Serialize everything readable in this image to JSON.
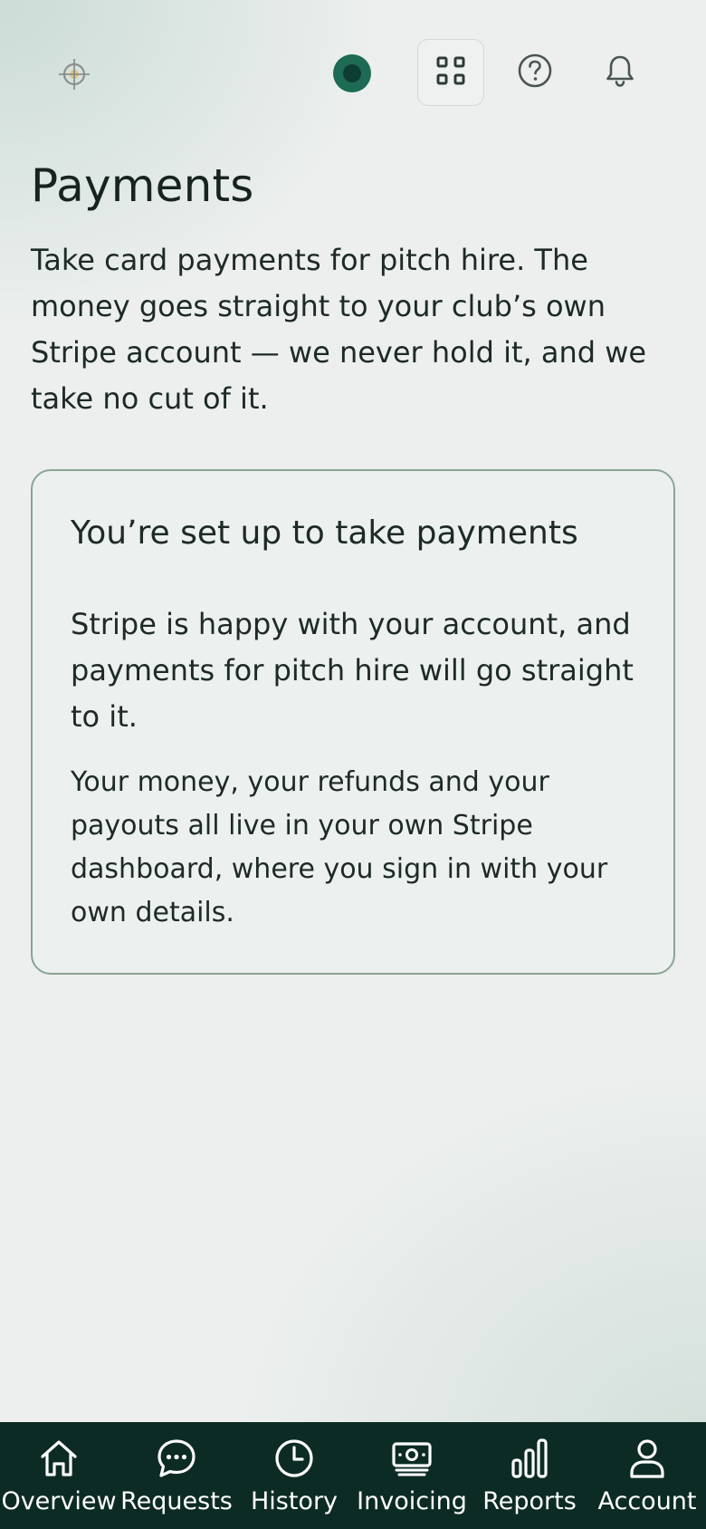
{
  "header": {
    "logo_icon": "target-crosshair-icon",
    "status_color": "#1d6b55",
    "apps_icon": "grid-icon",
    "help_icon": "help-icon",
    "notifications_icon": "bell-icon"
  },
  "main": {
    "title": "Payments",
    "intro": "Take card payments for pitch hire. The money goes straight to your club’s own Stripe account — we never hold it, and we take no cut of it.",
    "status_card": {
      "title": "You’re set up to take payments",
      "paragraph_1": "Stripe is happy with your account, and payments for pitch hire will go straight to it.",
      "paragraph_2": "Your money, your refunds and your payouts all live in your own Stripe dashboard, where you sign in with your own details.",
      "border_color": "#8aa595"
    }
  },
  "bottom_nav": {
    "background": "#0d2b25",
    "items": [
      {
        "label": "Overview",
        "icon": "home-icon"
      },
      {
        "label": "Requests",
        "icon": "chat-icon"
      },
      {
        "label": "History",
        "icon": "clock-icon"
      },
      {
        "label": "Invoicing",
        "icon": "banknote-icon"
      },
      {
        "label": "Reports",
        "icon": "bar-chart-icon"
      },
      {
        "label": "Account",
        "icon": "user-icon"
      }
    ]
  }
}
